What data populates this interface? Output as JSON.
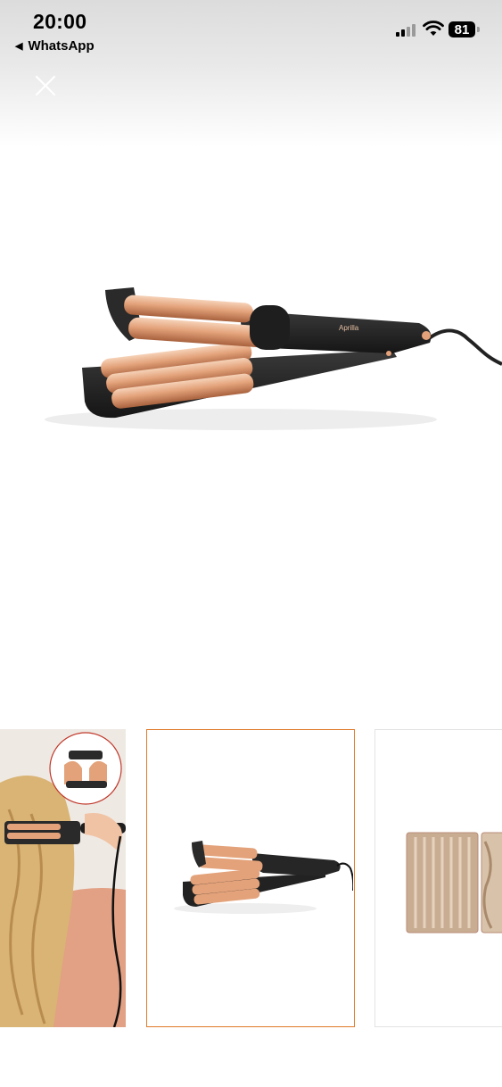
{
  "status_bar": {
    "time": "20:00",
    "back_app": "WhatsApp",
    "battery": "81",
    "signal_bars": "2 of 4 active",
    "icons": [
      "back-arrow-icon",
      "signal-icon",
      "wifi-icon",
      "battery-icon"
    ]
  },
  "viewer": {
    "close_icon": "close-icon",
    "main_image_alt": "triple barrel hair waver",
    "product_brand_text": "Aprilla"
  },
  "thumbnails": [
    {
      "name": "thumbnail-1",
      "selected": false
    },
    {
      "name": "thumbnail-2",
      "selected": true
    },
    {
      "name": "thumbnail-3",
      "selected": false
    }
  ],
  "colors": {
    "selected_border": "#e07b2a",
    "rose_gold": "#e4a47d",
    "device_black": "#262626"
  }
}
